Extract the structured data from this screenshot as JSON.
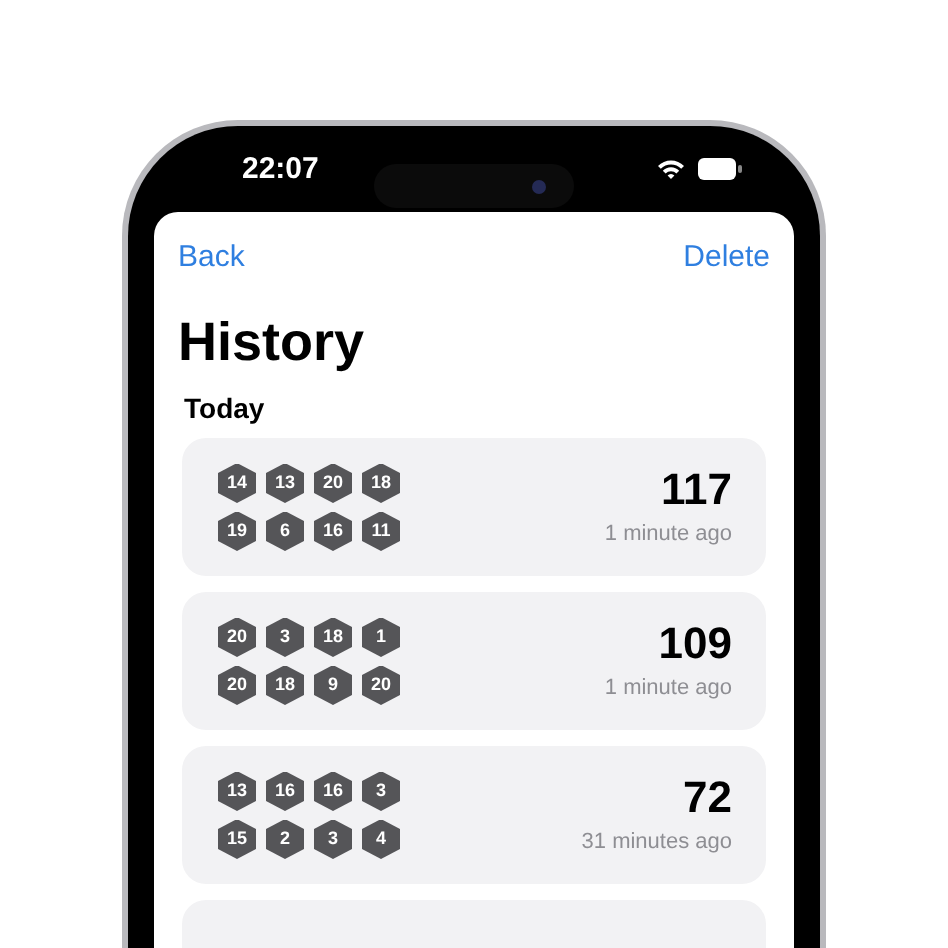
{
  "status_bar": {
    "time": "22:07"
  },
  "nav": {
    "back": "Back",
    "delete": "Delete"
  },
  "title": "History",
  "section": "Today",
  "rolls": [
    {
      "dice": [
        "14",
        "13",
        "20",
        "18",
        "19",
        "6",
        "16",
        "11"
      ],
      "total": "117",
      "time_ago": "1 minute ago"
    },
    {
      "dice": [
        "20",
        "3",
        "18",
        "1",
        "20",
        "18",
        "9",
        "20"
      ],
      "total": "109",
      "time_ago": "1 minute ago"
    },
    {
      "dice": [
        "13",
        "16",
        "16",
        "3",
        "15",
        "2",
        "3",
        "4"
      ],
      "total": "72",
      "time_ago": "31 minutes ago"
    }
  ]
}
